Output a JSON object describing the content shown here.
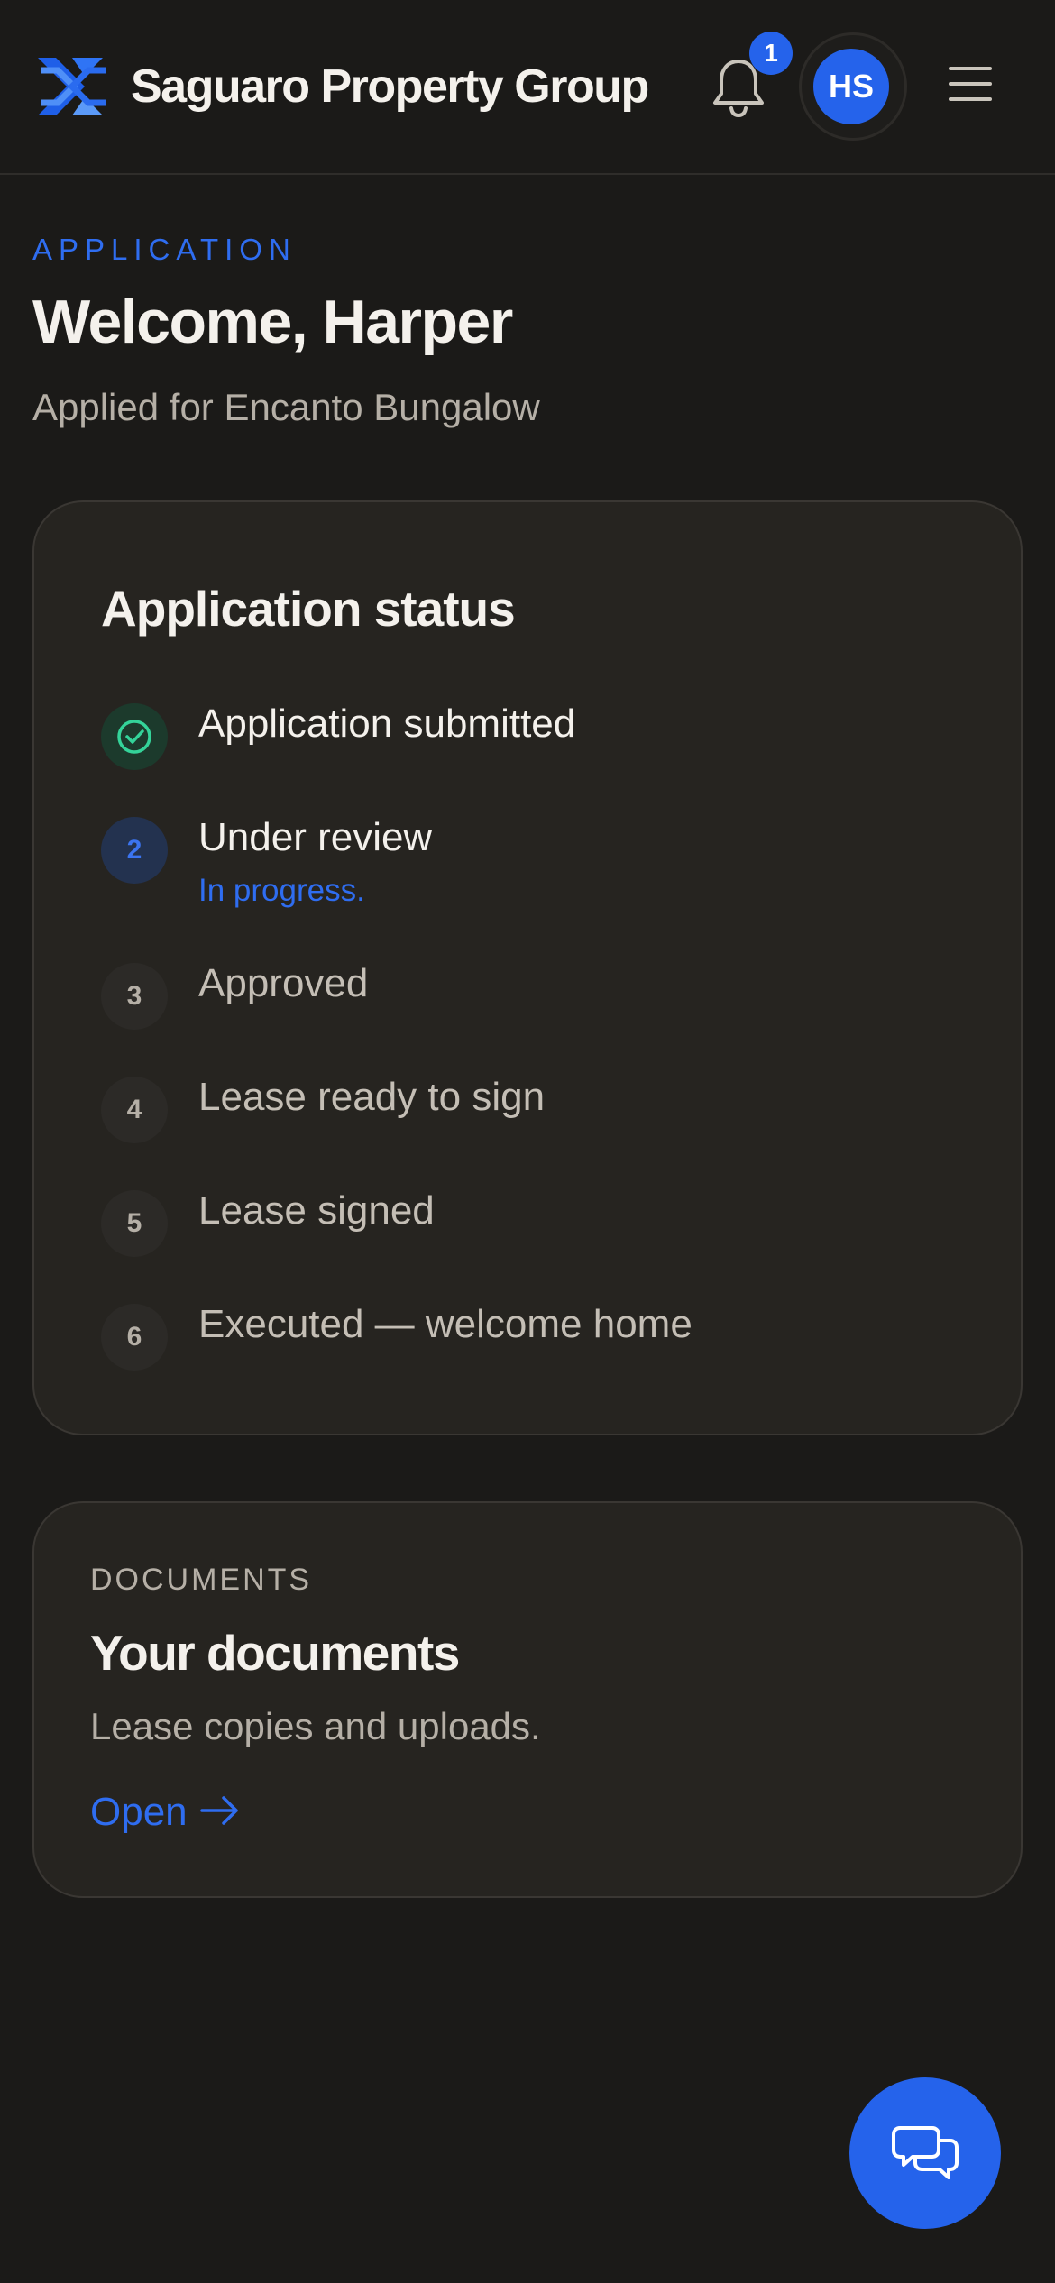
{
  "header": {
    "brand": "Saguaro Property Group",
    "notification_count": "1",
    "avatar_initials": "HS",
    "logo_icon": "brand-logo-icon",
    "bell_icon": "bell-icon",
    "menu_icon": "hamburger-menu-icon"
  },
  "intro": {
    "eyebrow": "APPLICATION",
    "title": "Welcome, Harper",
    "subtitle": "Applied for Encanto Bungalow"
  },
  "status": {
    "title": "Application status",
    "steps": [
      {
        "number": "",
        "label": "Application submitted",
        "state": "done",
        "icon": "check-icon"
      },
      {
        "number": "2",
        "label": "Under review",
        "state": "active",
        "note": "In progress."
      },
      {
        "number": "3",
        "label": "Approved",
        "state": "pending"
      },
      {
        "number": "4",
        "label": "Lease ready to sign",
        "state": "pending"
      },
      {
        "number": "5",
        "label": "Lease signed",
        "state": "pending"
      },
      {
        "number": "6",
        "label": "Executed — welcome home",
        "state": "pending"
      }
    ]
  },
  "documents": {
    "eyebrow": "DOCUMENTS",
    "title": "Your documents",
    "description": "Lease copies and uploads.",
    "link_label": "Open",
    "link_icon": "arrow-right-icon"
  },
  "chat": {
    "icon": "chat-bubbles-icon"
  },
  "colors": {
    "background": "#1b1a18",
    "card": "#262420",
    "accent": "#2563eb",
    "success": "#34d399",
    "muted_text": "#b5afa6"
  }
}
